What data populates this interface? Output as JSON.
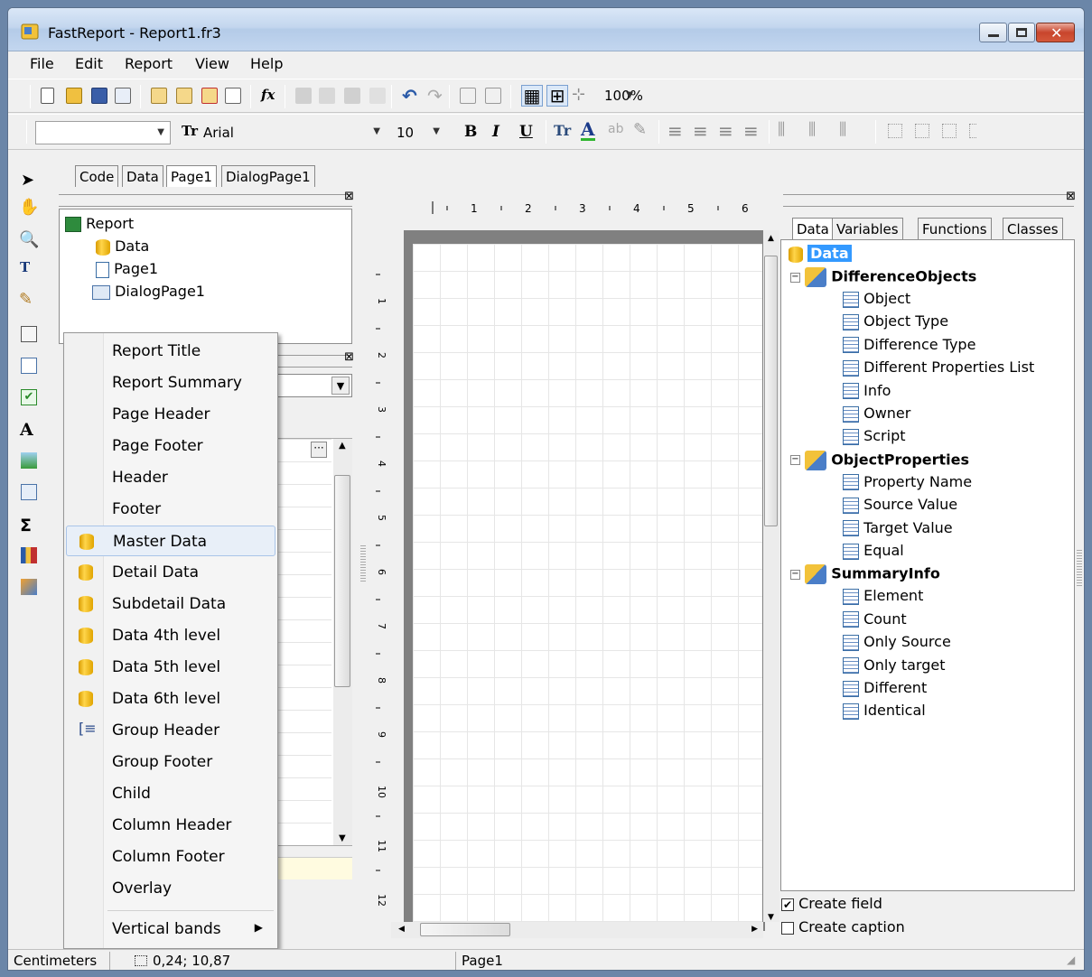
{
  "window": {
    "title": "FastReport - Report1.fr3"
  },
  "menu": [
    "File",
    "Edit",
    "Report",
    "View",
    "Help"
  ],
  "toolbar": {
    "zoom": "100%",
    "font_name": "Arial",
    "font_size": "10",
    "bold": "B",
    "italic": "I",
    "underline": "U"
  },
  "tabs": [
    "Code",
    "Data",
    "Page1",
    "DialogPage1"
  ],
  "report_tree": {
    "root": "Report",
    "items": [
      "Data",
      "Page1",
      "DialogPage1"
    ]
  },
  "context_menu": {
    "items": [
      "Report Title",
      "Report Summary",
      "Page Header",
      "Page Footer",
      "Header",
      "Footer",
      "Master Data",
      "Detail Data",
      "Subdetail Data",
      "Data 4th level",
      "Data 5th level",
      "Data 6th level",
      "Group Header",
      "Group Footer",
      "Child",
      "Column Header",
      "Column Footer",
      "Overlay",
      "Vertical bands"
    ],
    "selected": "Master Data"
  },
  "ruler": {
    "top": [
      "1",
      "2",
      "3",
      "4",
      "5",
      "6"
    ],
    "left": [
      "1",
      "2",
      "3",
      "4",
      "5",
      "6",
      "7",
      "8",
      "9",
      "10",
      "11",
      "12"
    ]
  },
  "data_tabs": [
    "Data",
    "Variables",
    "Functions",
    "Classes"
  ],
  "data_tree": {
    "root": "Data",
    "datasets": [
      {
        "name": "DifferenceObjects",
        "fields": [
          "Object",
          "Object Type",
          "Difference Type",
          "Different Properties List",
          "Info",
          "Owner",
          "Script"
        ]
      },
      {
        "name": "ObjectProperties",
        "fields": [
          "Property Name",
          "Source Value",
          "Target Value",
          "Equal"
        ]
      },
      {
        "name": "SummaryInfo",
        "fields": [
          "Element",
          "Count",
          "Only Source",
          "Only target",
          "Different",
          "Identical"
        ]
      }
    ]
  },
  "options": {
    "create_field": "Create field",
    "create_caption": "Create caption"
  },
  "statusbar": {
    "units": "Centimeters",
    "position": "0,24; 10,87",
    "page": "Page1"
  },
  "colors": {
    "selection": "#3399ff",
    "titlebar": "#c3d6ee",
    "close_button": "#c8452c"
  }
}
